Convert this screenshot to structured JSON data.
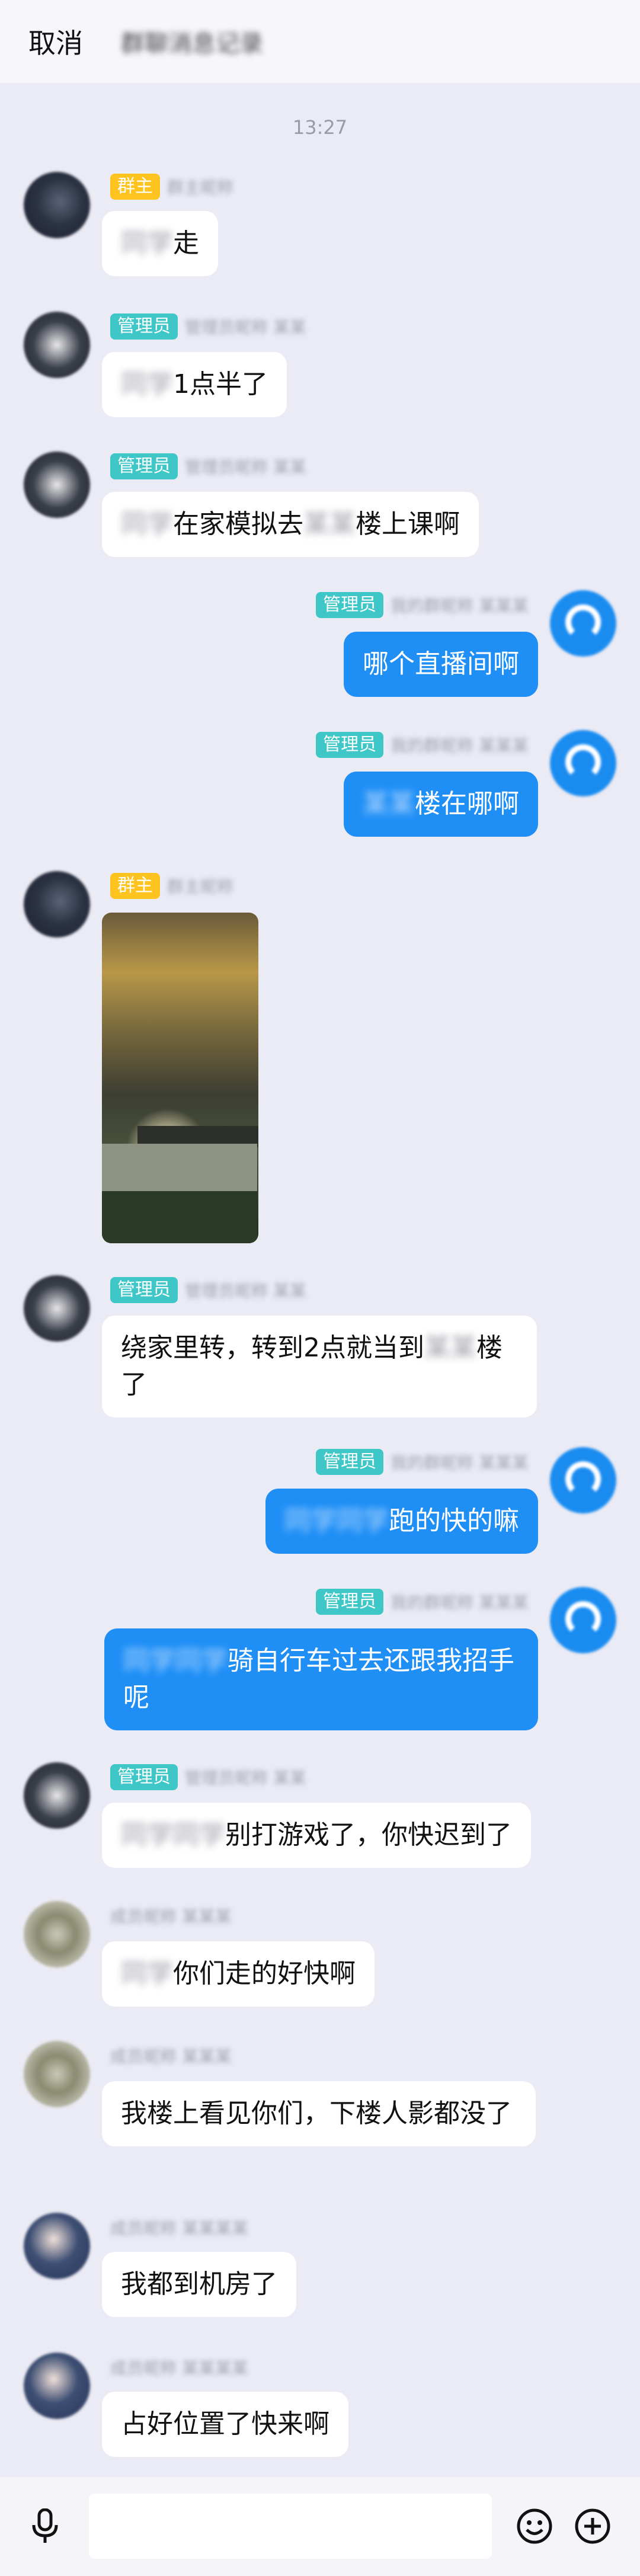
{
  "header": {
    "cancel_label": "取消",
    "title": "群聊消息记录"
  },
  "timestamp": "13:27",
  "badges": {
    "owner": "群主",
    "admin": "管理员"
  },
  "messages": [
    {
      "text_blur": "同学",
      "text": "走"
    },
    {
      "text_blur": "同学",
      "text": "1点半了"
    },
    {
      "text_blur": "同学",
      "text": "在家模拟去",
      "text_blur2": "某某",
      "text2": "楼上课啊"
    },
    {
      "text": "哪个直播间啊"
    },
    {
      "text_blur": "某某",
      "text": "楼在哪啊"
    },
    {
      "image": "photo-tree-sunset"
    },
    {
      "text": "绕家里转，转到2点就当到",
      "text_blur": "某某",
      "text2": "楼了"
    },
    {
      "text_blur": "同学同学",
      "text": "跑的快的嘛"
    },
    {
      "text_blur": "同学同学",
      "text": "骑自行车过去还跟我招手呢"
    },
    {
      "text_blur": "同学同学",
      "text": "别打游戏了，你快迟到了"
    },
    {
      "text_blur": "同学",
      "text": "你们走的好快啊"
    },
    {
      "text": "我楼上看见你们，下楼人影都没了"
    },
    {
      "text": "我都到机房了"
    },
    {
      "text": "占好位置了快来啊"
    }
  ],
  "nicks": {
    "owner": "群主昵称",
    "admin_a": "管理员昵称 某某",
    "me": "我的群昵称 某某某",
    "member_cat": "成员昵称 某某某",
    "member_anime": "成员昵称 某某某某"
  },
  "inputbar": {
    "mic_icon": "microphone-icon",
    "emoji_icon": "emoji-icon",
    "plus_icon": "plus-icon"
  }
}
